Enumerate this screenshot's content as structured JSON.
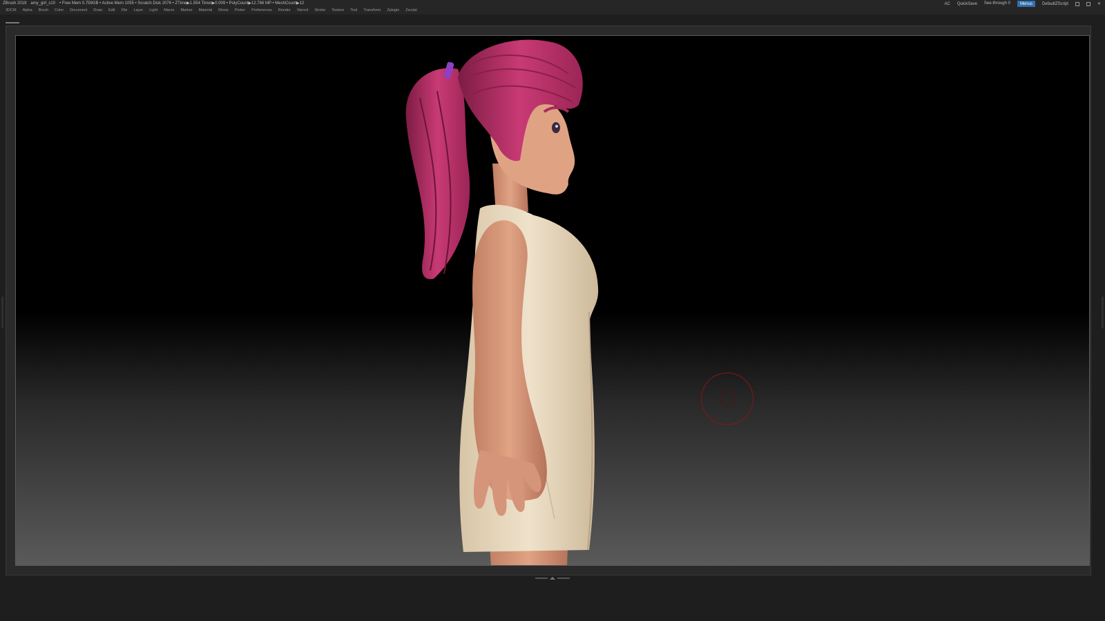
{
  "titlebar": {
    "app": "ZBrush 2019",
    "file": "amy_girl_s10",
    "stats": "• Free Mem 0.759GB • Active Mem 1055 • Scratch Disk 2076 • ZTime▶1.554 Timer▶0.009 • PolyCount▶12.786 MP • MeshCount▶12",
    "ac": "AC",
    "quicksave": "QuickSave",
    "see_through": "See-through  0",
    "menus_button": "Menus",
    "script": "DefaultZScript"
  },
  "menubar": {
    "items": [
      "3DCM",
      "Alpha",
      "Brush",
      "Color",
      "Document",
      "Draw",
      "Edit",
      "File",
      "Layer",
      "Light",
      "Macro",
      "Marker",
      "Material",
      "Movie",
      "Picker",
      "Preferences",
      "Render",
      "Stencil",
      "Stroke",
      "Texture",
      "Tool",
      "Transform",
      "Zplugin",
      "Zscript"
    ]
  },
  "colors": {
    "hair": "#c4336e",
    "hair_dark": "#8a1f4b",
    "skin": "#d9987a",
    "dress": "#e8d8bf",
    "hair_tie": "#8e3fc4",
    "brush_cursor": "#8a1616"
  },
  "icons": [
    "brush-cursor-icon",
    "close-icon",
    "maximize-icon",
    "minimize-icon"
  ]
}
